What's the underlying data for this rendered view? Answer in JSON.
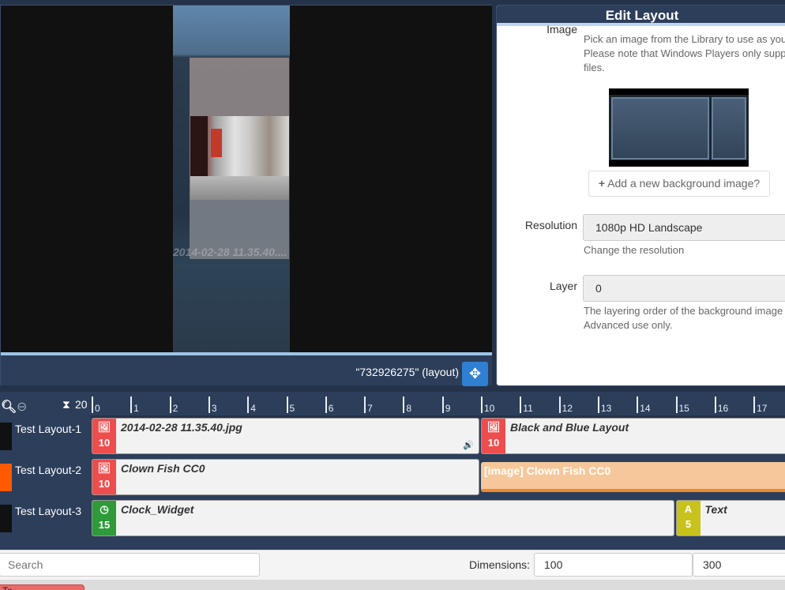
{
  "preview": {
    "region_caption": "2014-02-28 11.35.40....",
    "layout_label": "\"732926275\" (layout)",
    "move_icon": "arrows-move-icon"
  },
  "edit_layout": {
    "title": "Edit Layout",
    "background_image_label": "Image",
    "background_image_help_1": "Pick an image from the Library to use as your",
    "background_image_help_2": "Please note that Windows Players only suppo",
    "background_image_help_3": "files.",
    "add_background_button": "Add a new background image?",
    "resolution_label": "Resolution",
    "resolution_value": "1080p HD Landscape",
    "resolution_help": "Change the resolution",
    "layer_label": "Layer",
    "layer_value": "0",
    "layer_help_1": "The layering order of the background image (z",
    "layer_help_2": "Advanced use only."
  },
  "timeline": {
    "zoom_level": "20",
    "ruler_ticks": [
      "0",
      "1",
      "2",
      "3",
      "4",
      "5",
      "6",
      "7",
      "8",
      "9",
      "10",
      "11",
      "12",
      "13",
      "14",
      "15",
      "16",
      "17"
    ],
    "tracks": [
      {
        "name": "Test Layout-1",
        "swatch": "#111111",
        "widgets": [
          {
            "name": "2014-02-28 11.35.40.jpg",
            "duration": "10",
            "type": "image",
            "icon": "image-icon",
            "color": "#ee4d4d"
          },
          {
            "name": "Black and Blue Layout",
            "duration": "10",
            "type": "image",
            "icon": "image-icon",
            "color": "#ee4d4d"
          }
        ]
      },
      {
        "name": "Test Layout-2",
        "swatch": "#ff5a00",
        "widgets": [
          {
            "name": "Clown Fish CC0",
            "duration": "10",
            "type": "image",
            "icon": "image-icon",
            "color": "#ee4d4d"
          },
          {
            "name": "[image] Clown Fish CC0",
            "type": "ghost",
            "color": "#f5c79a"
          }
        ]
      },
      {
        "name": "Test Layout-3",
        "swatch": "#111111",
        "widgets": [
          {
            "name": "Clock_Widget",
            "duration": "15",
            "type": "clock",
            "icon": "clock-icon",
            "color": "#2e9a3a"
          },
          {
            "name": "Text",
            "duration": "5",
            "type": "text",
            "icon": "text-icon",
            "glyph": "A",
            "color": "#c8c21c"
          }
        ]
      }
    ]
  },
  "bottom_bar": {
    "search_placeholder": "Search",
    "dimensions_label": "Dimensions:",
    "width_value": "100",
    "height_value": "300",
    "footer_pill": "Te"
  }
}
